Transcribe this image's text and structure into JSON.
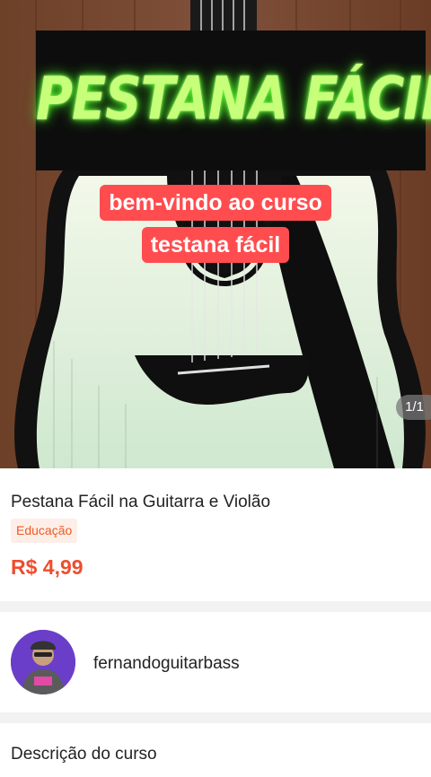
{
  "hero": {
    "banner_title": "PESTANA FÁCIL",
    "caption_line1": "bem-vindo ao curso",
    "caption_line2": "testana fácil",
    "pager": "1/1"
  },
  "product": {
    "title": "Pestana Fácil na Guitarra e Violão",
    "category": "Educação",
    "price": "R$ 4,99"
  },
  "creator": {
    "name": "fernandoguitarbass"
  },
  "description": {
    "heading": "Descrição do curso"
  },
  "colors": {
    "price": "#ee4d2d",
    "tag_bg": "#fdeee7",
    "caption_bg": "#ff4d4f",
    "neon_green": "#c8ff7a"
  }
}
